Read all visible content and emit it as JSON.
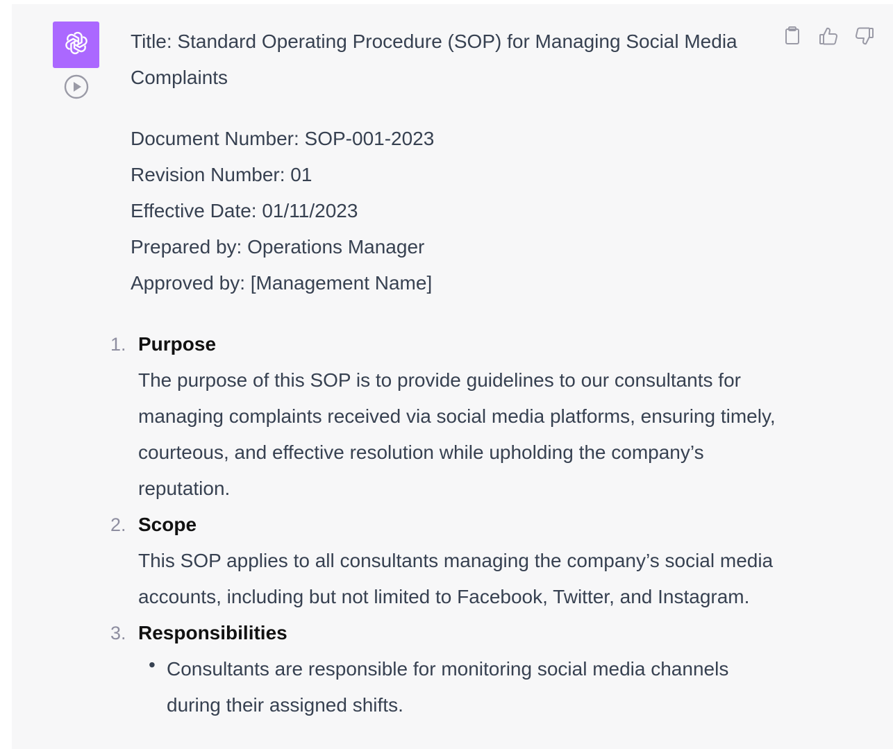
{
  "message": {
    "title": "Title: Standard Operating Procedure (SOP) for Managing Social Media Complaints",
    "meta": [
      "Document Number: SOP-001-2023",
      "Revision Number: 01",
      "Effective Date: 01/11/2023",
      "Prepared by: Operations Manager",
      "Approved by: [Management Name]"
    ],
    "sections": [
      {
        "number": "1.",
        "heading": "Purpose",
        "body": "The purpose of this SOP is to provide guidelines to our consultants for managing complaints received via social media platforms, ensuring timely, courteous, and effective resolution while upholding the company’s reputation."
      },
      {
        "number": "2.",
        "heading": "Scope",
        "body": "This SOP applies to all consultants managing the company’s social media accounts, including but not limited to Facebook, Twitter, and Instagram."
      },
      {
        "number": "3.",
        "heading": "Responsibilities",
        "bullets": [
          "Consultants are responsible for monitoring social media channels during their assigned shifts."
        ]
      }
    ]
  },
  "icons": {
    "avatar": "openai-logo-icon",
    "play": "play-circle-icon",
    "copy": "clipboard-icon",
    "like": "thumbs-up-icon",
    "dislike": "thumbs-down-icon"
  },
  "colors": {
    "avatar_bg": "#ab68ff",
    "panel_bg": "#f7f7f8",
    "text": "#374151",
    "heading": "#111111",
    "muted": "#8e8ea0"
  }
}
